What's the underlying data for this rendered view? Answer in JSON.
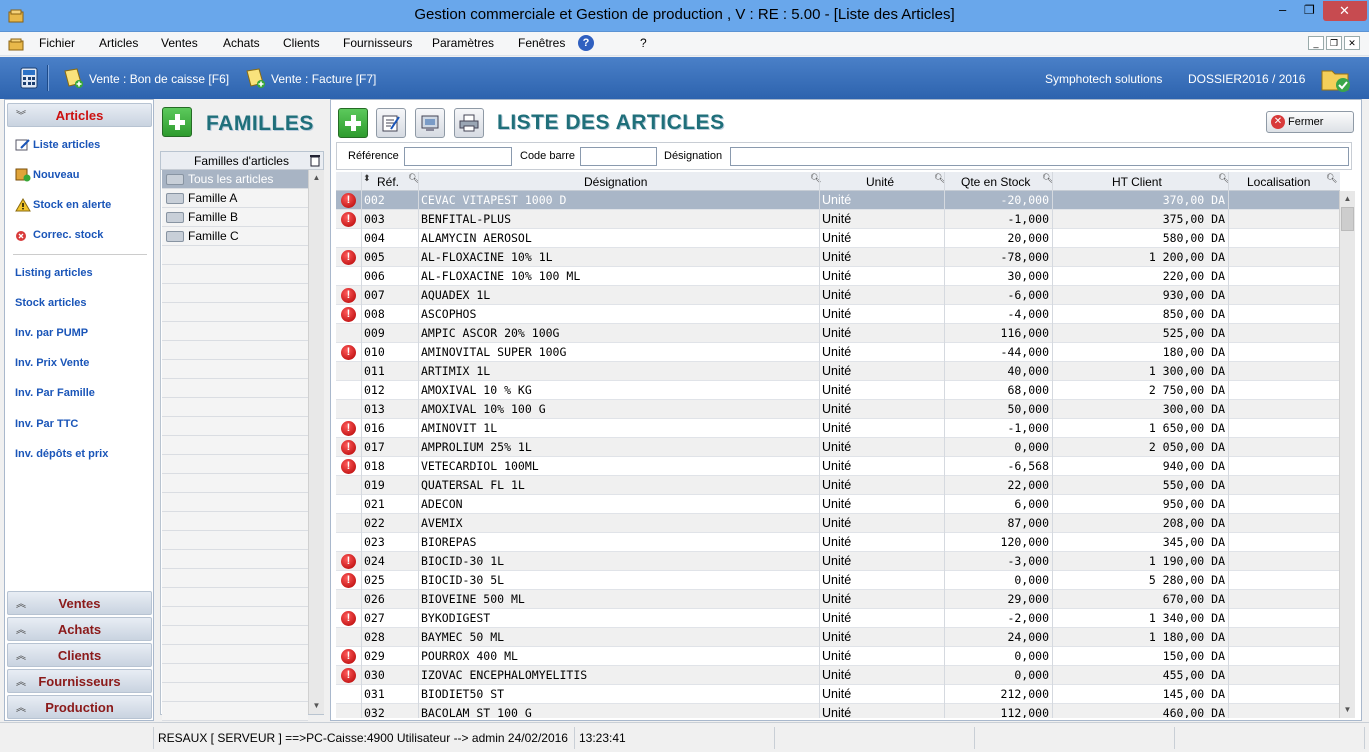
{
  "window": {
    "title": "Gestion commerciale et Gestion de production , V :  RE :  5.00 - [Liste des Articles]",
    "min": "–",
    "max": "❐",
    "close": "✕"
  },
  "menu": {
    "items": [
      "Fichier",
      "Articles",
      "Ventes",
      "Achats",
      "Clients",
      "Fournisseurs",
      "Paramètres",
      "Fenêtres"
    ],
    "help": "?",
    "question": "?",
    "mdi_min": "_",
    "mdi_restore": "❐",
    "mdi_close": "✕"
  },
  "toolbar": {
    "bon_caisse": "Vente : Bon de caisse [F6]",
    "facture": "Vente : Facture [F7]",
    "company": "Symphotech solutions",
    "dossier": "DOSSIER2016 / 2016"
  },
  "sidebar": {
    "active_section": "Articles",
    "actions": [
      "Liste articles",
      "Nouveau",
      "Stock en alerte",
      "Correc. stock"
    ],
    "reports": [
      "Listing articles",
      "Stock articles",
      "Inv. par PUMP",
      "Inv.  Prix Vente",
      "Inv.  Par Famille",
      "Inv.  Par TTC",
      "Inv. dépôts et prix"
    ],
    "sections": [
      "Ventes",
      "Achats",
      "Clients",
      "Fournisseurs",
      "Production"
    ]
  },
  "families": {
    "title": "FAMILLES",
    "header": "Familles d'articles",
    "items": [
      "Tous les articles",
      "Famille A",
      "Famille B",
      "Famille C"
    ]
  },
  "articles": {
    "title": "LISTE DES ARTICLES",
    "close_label": "Fermer",
    "filters": {
      "reference": "Référence",
      "code_barre": "Code barre",
      "designation": "Désignation"
    },
    "columns": {
      "ref": "Réf.",
      "designation": "Désignation",
      "unite": "Unité",
      "qte": "Qte en Stock",
      "ht": "HT Client",
      "loc": "Localisation"
    },
    "rows": [
      {
        "alert": true,
        "ref": "002",
        "des": "CEVAC VITAPEST 1000 D",
        "unite": "Unité",
        "qte": "-20,000",
        "ht": "370,00 DA"
      },
      {
        "alert": true,
        "ref": "003",
        "des": "BENFITAL-PLUS",
        "unite": "Unité",
        "qte": "-1,000",
        "ht": "375,00 DA"
      },
      {
        "alert": false,
        "ref": "004",
        "des": "ALAMYCIN AEROSOL",
        "unite": "Unité",
        "qte": "20,000",
        "ht": "580,00 DA"
      },
      {
        "alert": true,
        "ref": "005",
        "des": "AL-FLOXACINE 10% 1L",
        "unite": "Unité",
        "qte": "-78,000",
        "ht": "1 200,00 DA"
      },
      {
        "alert": false,
        "ref": "006",
        "des": "AL-FLOXACINE 10% 100 ML",
        "unite": "Unité",
        "qte": "30,000",
        "ht": "220,00 DA"
      },
      {
        "alert": true,
        "ref": "007",
        "des": "AQUADEX 1L",
        "unite": "Unité",
        "qte": "-6,000",
        "ht": "930,00 DA"
      },
      {
        "alert": true,
        "ref": "008",
        "des": "ASCOPHOS",
        "unite": "Unité",
        "qte": "-4,000",
        "ht": "850,00 DA"
      },
      {
        "alert": false,
        "ref": "009",
        "des": "AMPIC ASCOR 20% 100G",
        "unite": "Unité",
        "qte": "116,000",
        "ht": "525,00 DA"
      },
      {
        "alert": true,
        "ref": "010",
        "des": "AMINOVITAL SUPER 100G",
        "unite": "Unité",
        "qte": "-44,000",
        "ht": "180,00 DA"
      },
      {
        "alert": false,
        "ref": "011",
        "des": "ARTIMIX 1L",
        "unite": "Unité",
        "qte": "40,000",
        "ht": "1 300,00 DA"
      },
      {
        "alert": false,
        "ref": "012",
        "des": "AMOXIVAL 10 % KG",
        "unite": "Unité",
        "qte": "68,000",
        "ht": "2 750,00 DA"
      },
      {
        "alert": false,
        "ref": "013",
        "des": "AMOXIVAL 10% 100 G",
        "unite": "Unité",
        "qte": "50,000",
        "ht": "300,00 DA"
      },
      {
        "alert": true,
        "ref": "016",
        "des": "AMINOVIT 1L",
        "unite": "Unité",
        "qte": "-1,000",
        "ht": "1 650,00 DA"
      },
      {
        "alert": true,
        "ref": "017",
        "des": "AMPROLIUM 25% 1L",
        "unite": "Unité",
        "qte": "0,000",
        "ht": "2 050,00 DA"
      },
      {
        "alert": true,
        "ref": "018",
        "des": "VETECARDIOL 100ML",
        "unite": "Unité",
        "qte": "-6,568",
        "ht": "940,00 DA"
      },
      {
        "alert": false,
        "ref": "019",
        "des": "QUATERSAL FL 1L",
        "unite": "Unité",
        "qte": "22,000",
        "ht": "550,00 DA"
      },
      {
        "alert": false,
        "ref": "021",
        "des": "ADECON",
        "unite": "Unité",
        "qte": "6,000",
        "ht": "950,00 DA"
      },
      {
        "alert": false,
        "ref": "022",
        "des": "AVEMIX",
        "unite": "Unité",
        "qte": "87,000",
        "ht": "208,00 DA"
      },
      {
        "alert": false,
        "ref": "023",
        "des": "BIOREPAS",
        "unite": "Unité",
        "qte": "120,000",
        "ht": "345,00 DA"
      },
      {
        "alert": true,
        "ref": "024",
        "des": "BIOCID-30 1L",
        "unite": "Unité",
        "qte": "-3,000",
        "ht": "1 190,00 DA"
      },
      {
        "alert": true,
        "ref": "025",
        "des": "BIOCID-30 5L",
        "unite": "Unité",
        "qte": "0,000",
        "ht": "5 280,00 DA"
      },
      {
        "alert": false,
        "ref": "026",
        "des": "BIOVEINE 500 ML",
        "unite": "Unité",
        "qte": "29,000",
        "ht": "670,00 DA"
      },
      {
        "alert": true,
        "ref": "027",
        "des": "BYKODIGEST",
        "unite": "Unité",
        "qte": "-2,000",
        "ht": "1 340,00 DA"
      },
      {
        "alert": false,
        "ref": "028",
        "des": "BAYMEC 50 ML",
        "unite": "Unité",
        "qte": "24,000",
        "ht": "1 180,00 DA"
      },
      {
        "alert": true,
        "ref": "029",
        "des": "POURROX 400 ML",
        "unite": "Unité",
        "qte": "0,000",
        "ht": "150,00 DA"
      },
      {
        "alert": true,
        "ref": "030",
        "des": "IZOVAC ENCEPHALOMYELITIS",
        "unite": "Unité",
        "qte": "0,000",
        "ht": "455,00 DA"
      },
      {
        "alert": false,
        "ref": "031",
        "des": "BIODIET50 ST",
        "unite": "Unité",
        "qte": "212,000",
        "ht": "145,00 DA"
      },
      {
        "alert": false,
        "ref": "032",
        "des": "BACOLAM ST 100 G",
        "unite": "Unité",
        "qte": "112,000",
        "ht": "460,00 DA"
      }
    ]
  },
  "status": {
    "connection": "RESAUX [ SERVEUR ] ==>PC-Caisse:4900 Utilisateur -->  admin 24/02/2016",
    "time": "13:23:41"
  },
  "colors": {
    "titlebar": "#69a7eb",
    "toolbar": "#2d63ae",
    "heading": "#1f6f7a",
    "alert": "#cc0000",
    "link": "#1a55b8"
  }
}
